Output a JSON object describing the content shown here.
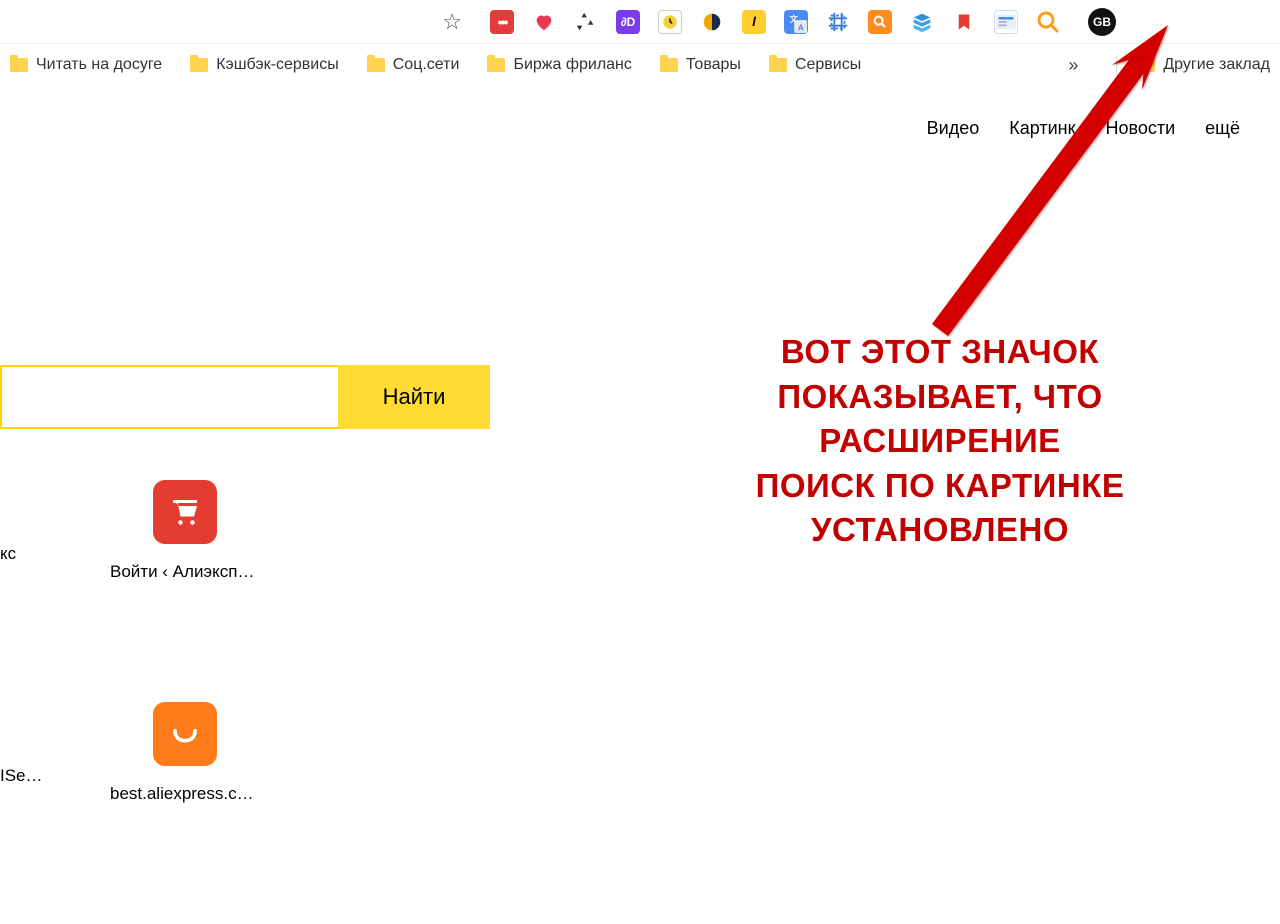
{
  "toolbar": {
    "star_tooltip": "☆",
    "profile_initials": "GB"
  },
  "bookmarks": {
    "items": [
      "Читать на досуге",
      "Кэшбэк-сервисы",
      "Соц.сети",
      "Биржа фриланс",
      "Товары",
      "Сервисы"
    ],
    "overflow": "»",
    "other_label": "Другие заклад"
  },
  "nav": {
    "video": "Видео",
    "images": "Картинк",
    "news": "Новости",
    "more": "ещё"
  },
  "search": {
    "button_label": "Найти"
  },
  "tiles": {
    "row1_left_label": "кс",
    "row1_right_label": "Войти ‹ Алиэкспр...",
    "row2_left_label": "ISense",
    "row2_right_label": "best.aliexpress.com"
  },
  "annotation": {
    "line1": "ВОТ ЭТОТ ЗНАЧОК",
    "line2": "ПОКАЗЫВАЕТ, ЧТО",
    "line3": "РАСШИРЕНИЕ",
    "line4": "ПОИСК ПО КАРТИНКЕ",
    "line5": "УСТАНОВЛЕНО"
  }
}
